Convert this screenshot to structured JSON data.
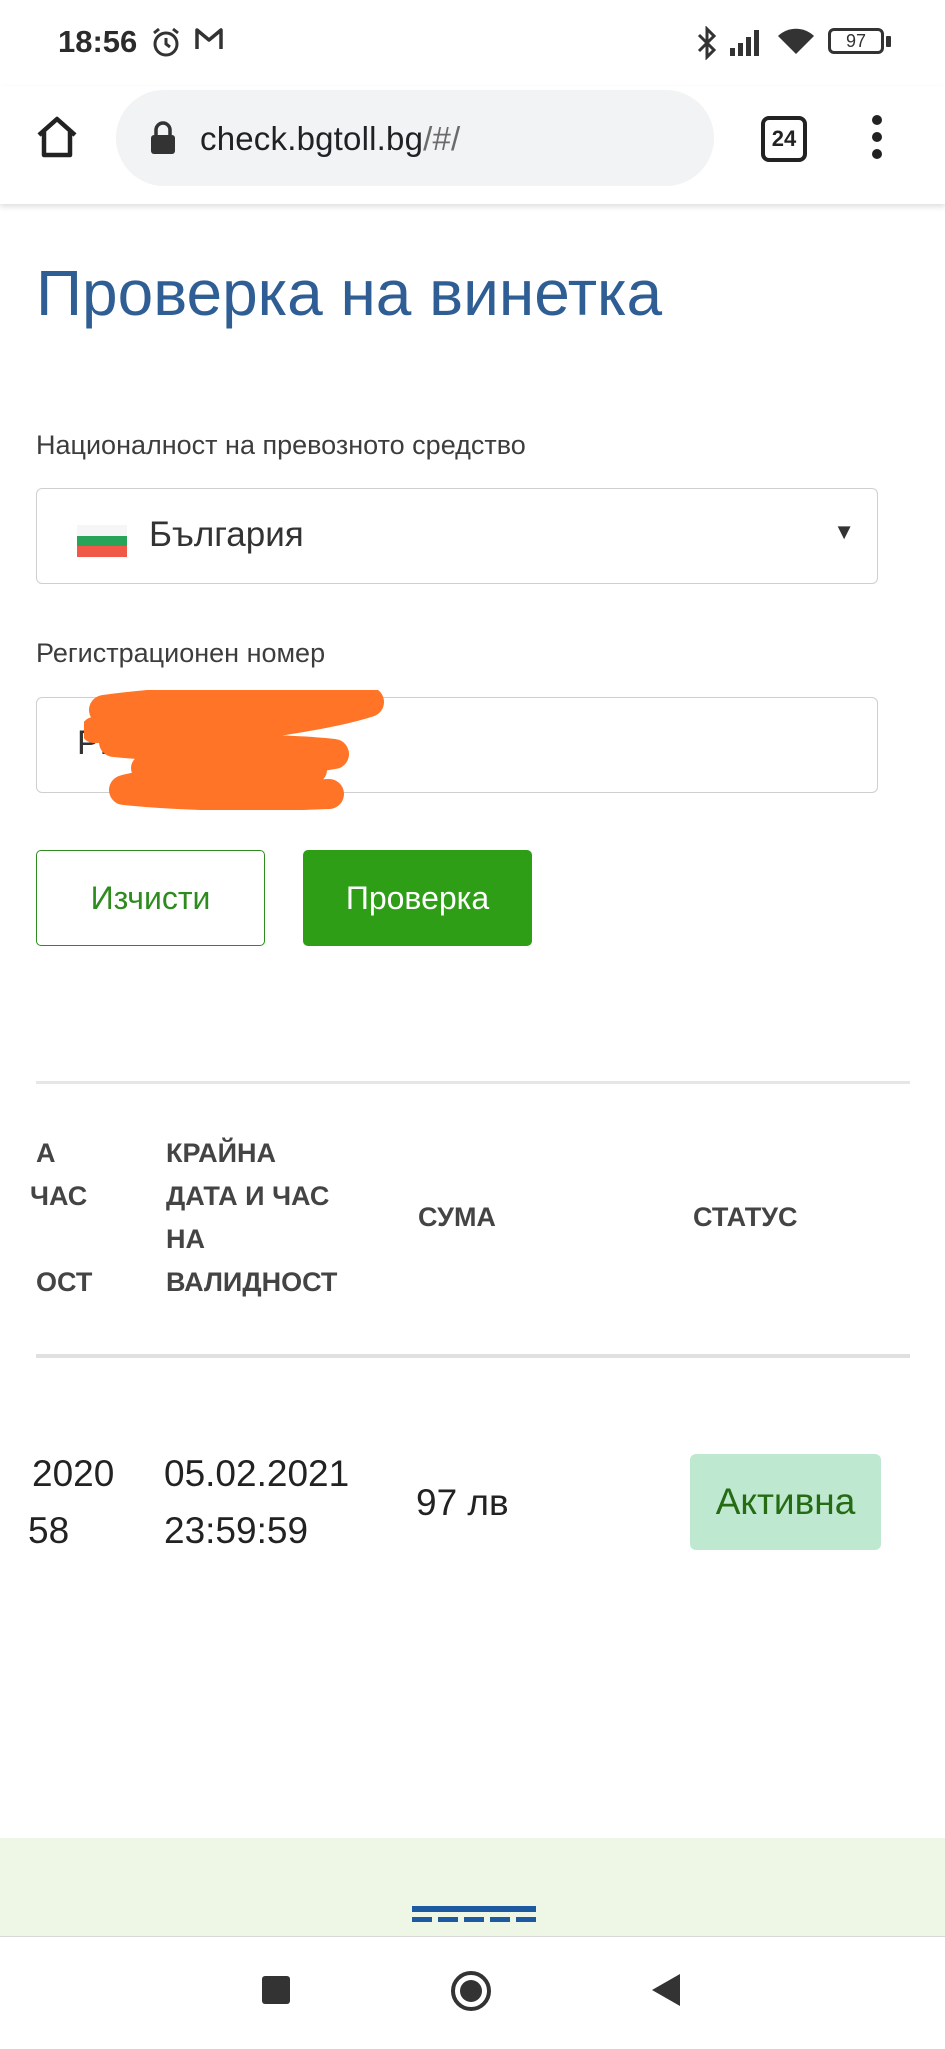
{
  "status_bar": {
    "time": "18:56",
    "battery": "97",
    "icons": [
      "alarm-icon",
      "gmail-icon",
      "bluetooth-icon",
      "signal-icon",
      "wifi-icon",
      "battery-icon"
    ]
  },
  "browser": {
    "url_host": "check.bgtoll.bg",
    "url_path": "/#/",
    "tab_count": "24",
    "icons": [
      "home-icon",
      "lock-icon",
      "tabs-icon",
      "more-vert-icon"
    ]
  },
  "page": {
    "title": "Проверка на винетка",
    "nationality_label": "Националност на превозното средство",
    "nationality_value": "България",
    "registration_label": "Регистрационен номер",
    "registration_value": "PB",
    "clear_button": "Изчисти",
    "check_button": "Проверка"
  },
  "table": {
    "columns_partial": {
      "start_line1": "А",
      "start_line2": "ЧАС",
      "start_line4": "ОСТ"
    },
    "columns": {
      "end_line1": "КРАЙНА",
      "end_line2": "ДАТА И ЧАС",
      "end_line3": "НА",
      "end_line4": "ВАЛИДНОСТ",
      "amount": "СУМА",
      "status": "СТАТУС"
    },
    "row": {
      "start_date_partial": "2020",
      "start_time_partial": "58",
      "end_date": "05.02.2021",
      "end_time": "23:59:59",
      "amount": "97 лв",
      "status": "Активна"
    }
  },
  "colors": {
    "title": "#2f5e94",
    "primary_green": "#2f9e17",
    "active_badge": "#bfe8d0",
    "footer_bg": "#eef7e6",
    "flag": [
      "#ffffff",
      "#00966e",
      "#d62612"
    ]
  },
  "nav_icons": [
    "recents-square-icon",
    "home-circle-icon",
    "back-triangle-icon"
  ]
}
